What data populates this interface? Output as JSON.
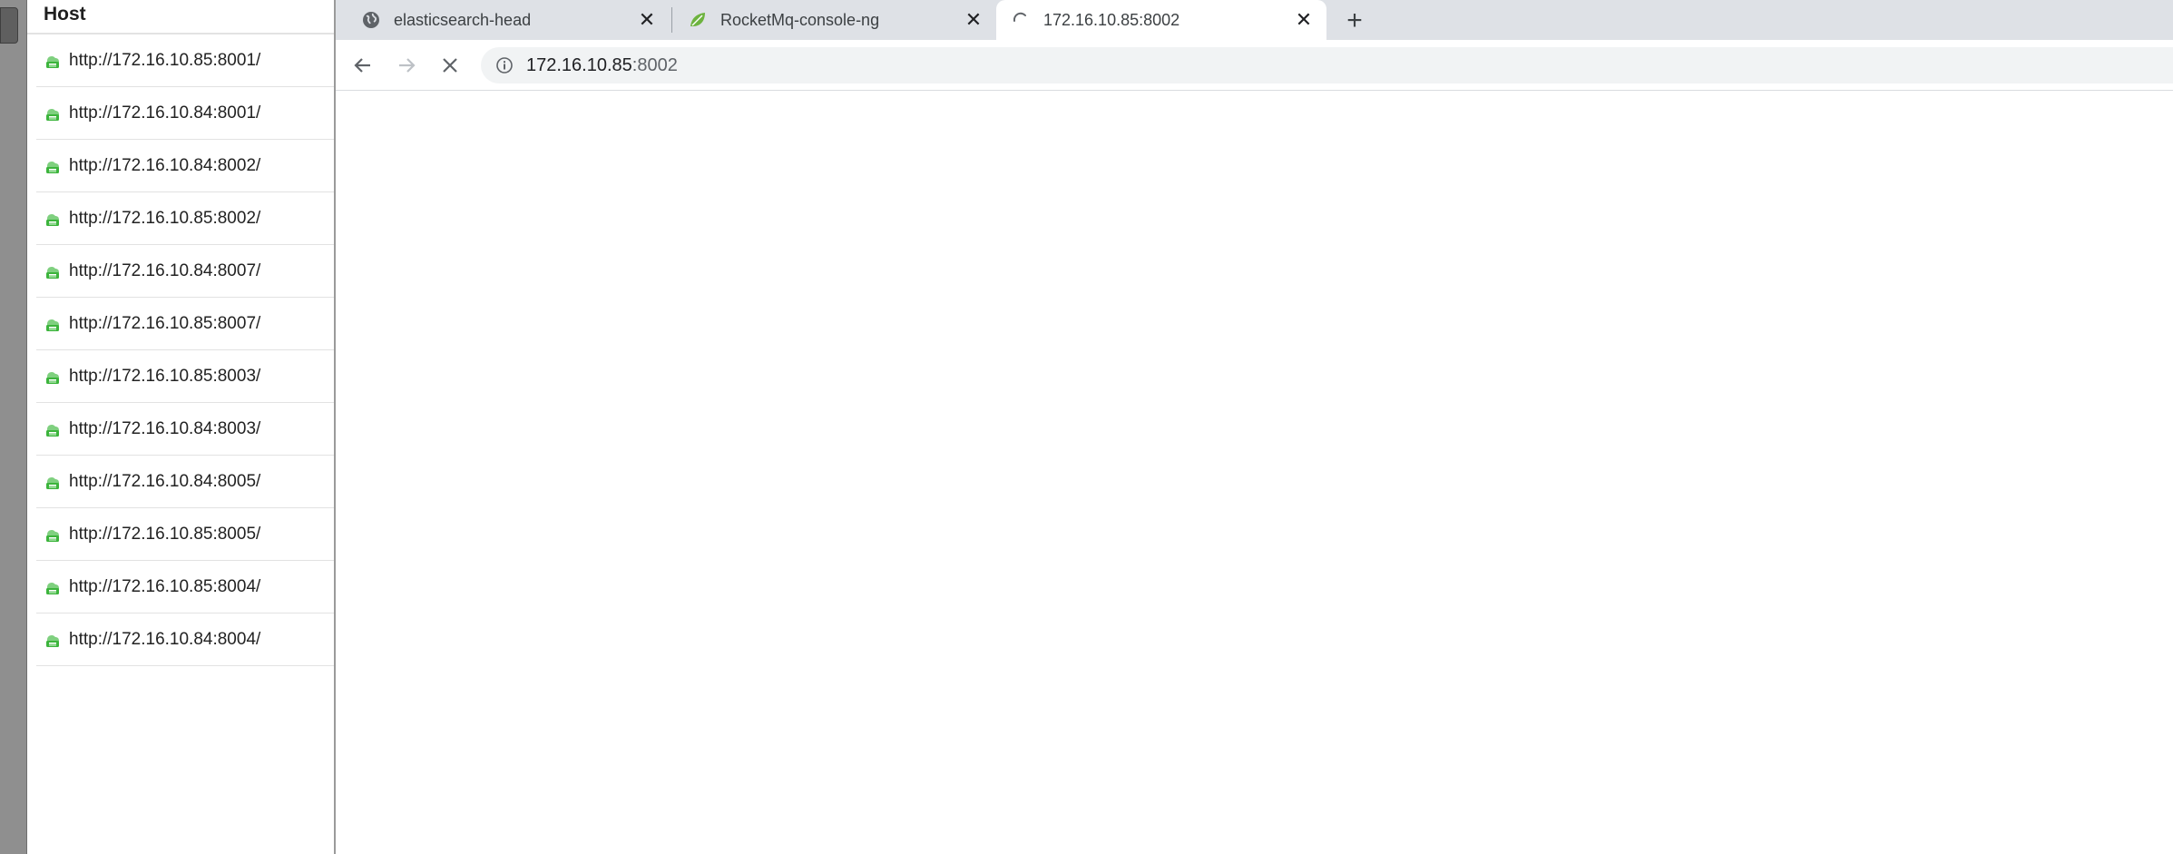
{
  "host_panel": {
    "header": "Host",
    "hosts": [
      "http://172.16.10.85:8001/",
      "http://172.16.10.84:8001/",
      "http://172.16.10.84:8002/",
      "http://172.16.10.85:8002/",
      "http://172.16.10.84:8007/",
      "http://172.16.10.85:8007/",
      "http://172.16.10.85:8003/",
      "http://172.16.10.84:8003/",
      "http://172.16.10.84:8005/",
      "http://172.16.10.85:8005/",
      "http://172.16.10.85:8004/",
      "http://172.16.10.84:8004/"
    ],
    "host_icon": "green-cloud-server-icon",
    "icon_color": "#3cb43c"
  },
  "browser": {
    "tabs": [
      {
        "title": "elasticsearch-head",
        "icon": "globe-icon"
      },
      {
        "title": "RocketMq-console-ng",
        "icon": "spring-leaf-icon"
      },
      {
        "title": "172.16.10.85:8002",
        "icon": "loading-spinner-icon",
        "active": true
      }
    ],
    "new_tab_label": "+",
    "close_label": "✕",
    "address": {
      "host": "172.16.10.85",
      "port": ":8002"
    },
    "colors": {
      "tab_strip": "#dee1e6",
      "omnibox": "#f1f3f4",
      "spring_green": "#6db33f"
    }
  }
}
